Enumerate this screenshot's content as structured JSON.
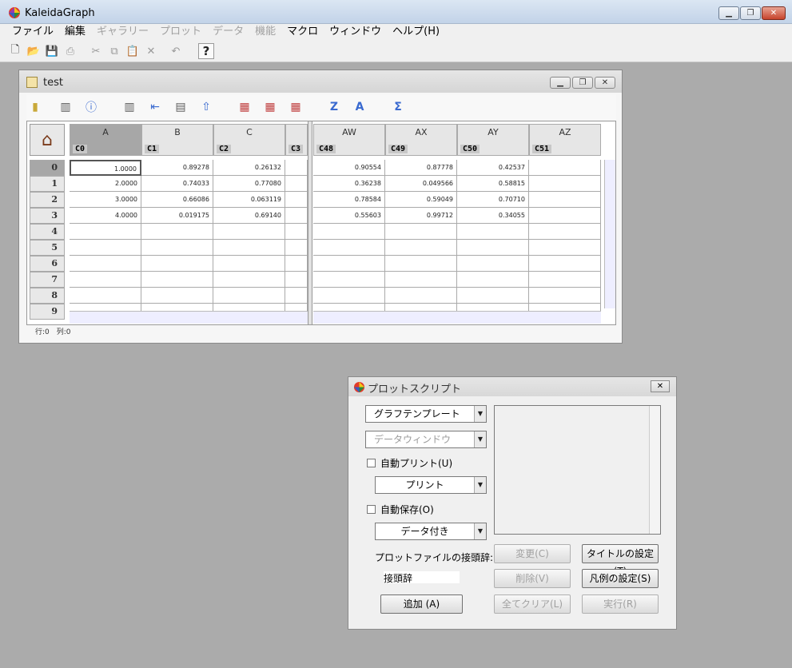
{
  "app": {
    "title": "KaleidaGraph",
    "minimize": "▁",
    "restore": "❐",
    "close": "✕"
  },
  "menu": [
    "ファイル",
    "編集",
    "ギャラリー",
    "プロット",
    "データ",
    "機能",
    "マクロ",
    "ウィンドウ",
    "ヘルプ(H)"
  ],
  "menu_disabled": [
    false,
    false,
    true,
    true,
    true,
    true,
    false,
    false,
    false
  ],
  "datawin": {
    "title": "test",
    "columns_left": [
      {
        "letter": "A",
        "num": "C0"
      },
      {
        "letter": "B",
        "num": "C1"
      },
      {
        "letter": "C",
        "num": "C2"
      },
      {
        "letter": "",
        "num": "C3"
      }
    ],
    "columns_right": [
      {
        "letter": "AW",
        "num": "C48"
      },
      {
        "letter": "AX",
        "num": "C49"
      },
      {
        "letter": "AY",
        "num": "C50"
      },
      {
        "letter": "AZ",
        "num": "C51"
      }
    ],
    "rows": [
      "0",
      "1",
      "2",
      "3",
      "4",
      "5",
      "6",
      "7",
      "8",
      "9"
    ],
    "cells_left": [
      [
        "1.0000",
        "0.89278",
        "0.26132"
      ],
      [
        "2.0000",
        "0.74033",
        "0.77080"
      ],
      [
        "3.0000",
        "0.66086",
        "0.063119"
      ],
      [
        "4.0000",
        "0.019175",
        "0.69140"
      ]
    ],
    "cells_right": [
      [
        "0.90554",
        "0.87778",
        "0.42537"
      ],
      [
        "0.36238",
        "0.049566",
        "0.58815"
      ],
      [
        "0.78584",
        "0.59049",
        "0.70710"
      ],
      [
        "0.55603",
        "0.99712",
        "0.34055"
      ]
    ],
    "status": "行:0　列:0"
  },
  "dialog": {
    "title": "プロットスクリプト",
    "close": "✕",
    "template_select": "グラフテンプレート",
    "data_window_select": "データウィンドウ",
    "auto_print_label": "自動プリント(U)",
    "print_select": "プリント",
    "auto_save_label": "自動保存(O)",
    "data_select": "データ付き",
    "prefix_label": "プロットファイルの接頭辞:",
    "prefix_value": "接頭辞",
    "add_button": "追加 (A)",
    "change_button": "変更(C)",
    "delete_button": "削除(V)",
    "clear_all_button": "全てクリア(L)",
    "set_title_button": "タイトルの設定(T)",
    "set_legend_button": "凡例の設定(S)",
    "run_button": "実行(R)"
  }
}
